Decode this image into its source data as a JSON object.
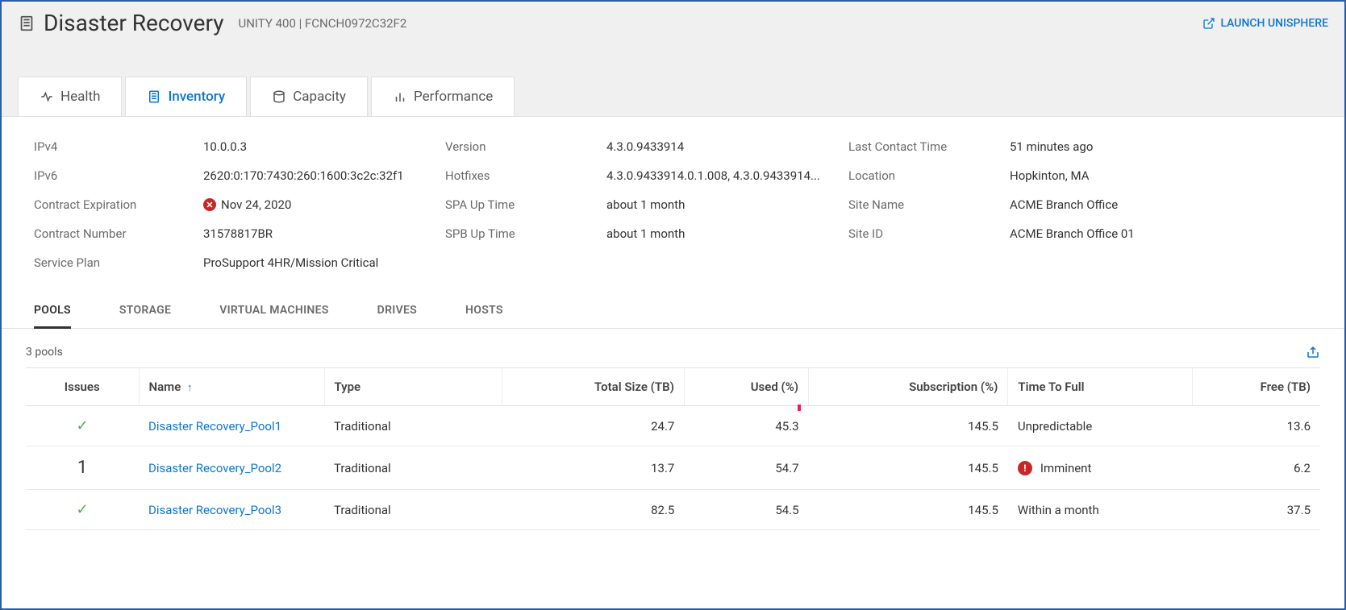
{
  "header": {
    "title": "Disaster Recovery",
    "system": "UNITY 400 | FCNCH0972C32F2",
    "launch_label": "LAUNCH UNISPHERE"
  },
  "tabs": {
    "health": "Health",
    "inventory": "Inventory",
    "capacity": "Capacity",
    "performance": "Performance"
  },
  "details": {
    "ipv4_label": "IPv4",
    "ipv4": "10.0.0.3",
    "ipv6_label": "IPv6",
    "ipv6": "2620:0:170:7430:260:1600:3c2c:32f1",
    "contract_exp_label": "Contract Expiration",
    "contract_exp": "Nov 24, 2020",
    "contract_num_label": "Contract Number",
    "contract_num": "31578817BR",
    "service_plan_label": "Service Plan",
    "service_plan": "ProSupport 4HR/Mission Critical",
    "version_label": "Version",
    "version": "4.3.0.9433914",
    "hotfixes_label": "Hotfixes",
    "hotfixes": "4.3.0.9433914.0.1.008, 4.3.0.9433914...",
    "spa_label": "SPA Up Time",
    "spa": "about 1 month",
    "spb_label": "SPB Up Time",
    "spb": "about 1 month",
    "last_contact_label": "Last Contact Time",
    "last_contact": "51 minutes ago",
    "location_label": "Location",
    "location": "Hopkinton, MA",
    "site_name_label": "Site Name",
    "site_name": "ACME Branch Office",
    "site_id_label": "Site ID",
    "site_id": "ACME Branch Office 01"
  },
  "sub_tabs": {
    "pools": "POOLS",
    "storage": "STORAGE",
    "vms": "VIRTUAL MACHINES",
    "drives": "DRIVES",
    "hosts": "HOSTS"
  },
  "table": {
    "count_label": "3 pools",
    "columns": {
      "issues": "Issues",
      "name": "Name",
      "type": "Type",
      "total": "Total Size (TB)",
      "used": "Used (%)",
      "sub": "Subscription (%)",
      "ttf": "Time To Full",
      "free": "Free (TB)"
    },
    "rows": [
      {
        "issues": "ok",
        "name": "Disaster Recovery_Pool1",
        "type": "Traditional",
        "total": "24.7",
        "used": "45.3",
        "sub": "145.5",
        "ttf": "Unpredictable",
        "ttf_alert": false,
        "free": "13.6"
      },
      {
        "issues": "1",
        "name": "Disaster Recovery_Pool2",
        "type": "Traditional",
        "total": "13.7",
        "used": "54.7",
        "sub": "145.5",
        "ttf": "Imminent",
        "ttf_alert": true,
        "free": "6.2"
      },
      {
        "issues": "ok",
        "name": "Disaster Recovery_Pool3",
        "type": "Traditional",
        "total": "82.5",
        "used": "54.5",
        "sub": "145.5",
        "ttf": "Within a month",
        "ttf_alert": false,
        "free": "37.5"
      }
    ]
  }
}
